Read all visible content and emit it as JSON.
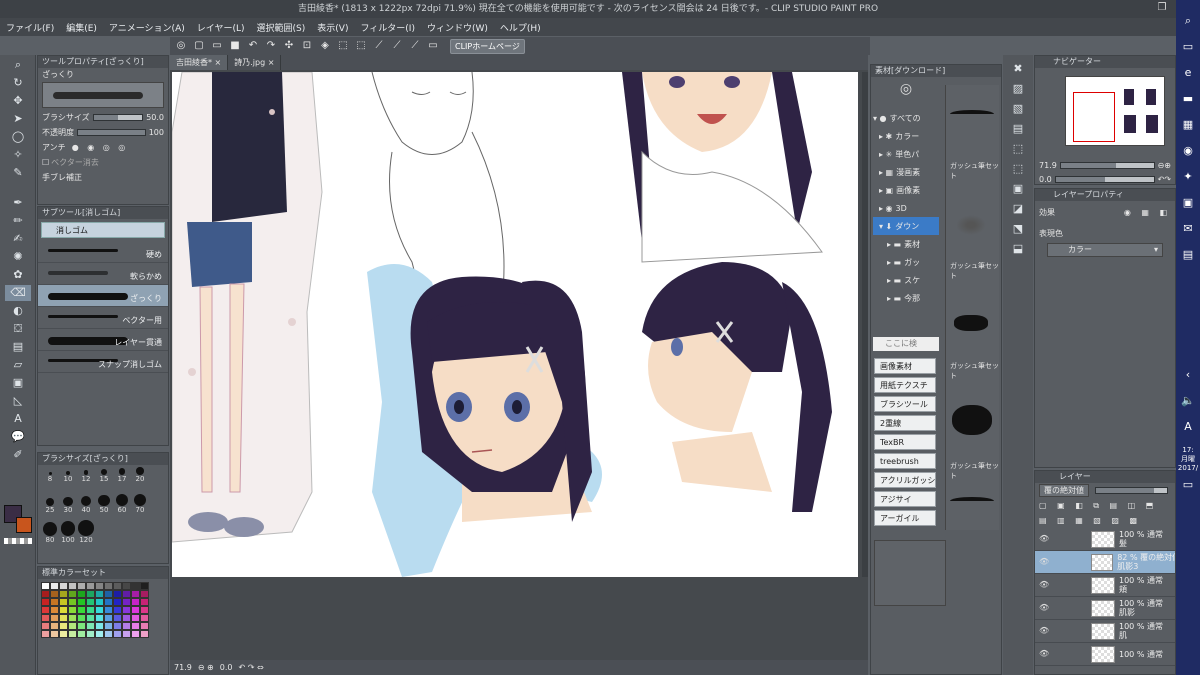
{
  "window": {
    "title": "吉田綾香* (1813 x 1222px 72dpi 71.9%)  現在全ての機能を使用可能です - 次のライセンス開会は 24 日後です。- CLIP STUDIO PAINT PRO"
  },
  "menu": [
    "ファイル(F)",
    "編集(E)",
    "アニメーション(A)",
    "レイヤー(L)",
    "選択範囲(S)",
    "表示(V)",
    "フィルター(I)",
    "ウィンドウ(W)",
    "ヘルプ(H)"
  ],
  "command_bar": {
    "clip_home_label": "CLIPホームページ"
  },
  "canvas_tabs": [
    {
      "label": "吉田綾香*"
    },
    {
      "label": "詩乃.jpg"
    }
  ],
  "tool_property": {
    "header": "ツールプロパティ[ざっくり]",
    "brush_name": "ざっくり",
    "brush_size_label": "ブラシサイズ",
    "brush_size_value": "50.0",
    "opacity_label": "不透明度",
    "opacity_value": "100",
    "antialias_label": "アンチ",
    "vector_eraser_label": "ベクター消去",
    "stabilization_label": "手ブレ補正",
    "brush_size_fraction": 0.5,
    "opacity_fraction": 1.0
  },
  "sub_tool": {
    "header": "サブツール[消しゴム]",
    "group_label": "消しゴム",
    "items": [
      {
        "label": "硬め"
      },
      {
        "label": "軟らかめ"
      },
      {
        "label": "ざっくり"
      },
      {
        "label": "ベクター用"
      },
      {
        "label": "レイヤー貫通"
      },
      {
        "label": "スナップ消しゴム"
      }
    ]
  },
  "brush_size_palette": {
    "header": "ブラシサイズ[ざっくり]",
    "sizes": [
      "8",
      "10",
      "12",
      "15",
      "17",
      "20",
      "25",
      "30",
      "40",
      "50",
      "60",
      "70",
      "80",
      "100",
      "120"
    ]
  },
  "color_set": {
    "header": "標準カラーセット"
  },
  "material_panel": {
    "header": "素材[ダウンロード]",
    "tree": [
      {
        "label": "すべての"
      },
      {
        "label": "カラー"
      },
      {
        "label": "単色パ"
      },
      {
        "label": "漫画素"
      },
      {
        "label": "画像素"
      },
      {
        "label": "3D"
      },
      {
        "label": "ダウン"
      },
      {
        "label": "素材"
      },
      {
        "label": "ガッ"
      },
      {
        "label": "スケ"
      },
      {
        "label": "今那"
      }
    ],
    "search_placeholder": "ここに検",
    "tags": [
      "画像素材",
      "用紙テクスチ",
      "ブラシツール",
      "2重線",
      "TexBR",
      "treebrush",
      "アクリルガッシ",
      "アジサイ",
      "アーガイル"
    ],
    "preview_labels": [
      "ガッシュ筆セット",
      "ガッシュ筆セット",
      "ガッシュ筆セット",
      "ガッシュ筆セット"
    ]
  },
  "navigator": {
    "header": "ナビゲーター",
    "zoom": "71.9",
    "rotation": "0.0"
  },
  "layer_property": {
    "header": "レイヤープロパティ",
    "effect_label": "効果",
    "expression_color_label": "表現色",
    "expression_color_value": "カラー"
  },
  "layers": {
    "header": "レイヤー",
    "blend_mode": "覆の絶対値",
    "rows": [
      {
        "line1": "100 % 通常",
        "line2": "髪"
      },
      {
        "line1": "82 % 覆の絶対値",
        "line2": "肌影3"
      },
      {
        "line1": "100 % 通常",
        "line2": "頬"
      },
      {
        "line1": "100 % 通常",
        "line2": "肌影"
      },
      {
        "line1": "100 % 通常",
        "line2": "肌"
      },
      {
        "line1": "100 % 通常",
        "line2": ""
      }
    ]
  },
  "status": {
    "zoom": "71.9",
    "rotation": "0.0"
  },
  "taskbar": {
    "time": "17:",
    "date_part": "月曜",
    "year": "2017/"
  },
  "colors": {
    "accent": "#2a64c8",
    "panel_bg": "#595d62",
    "main_color": "#3a2d45",
    "sub_color": "#c8551d",
    "hair": "#2e2344",
    "skin": "#f6ddc6"
  }
}
